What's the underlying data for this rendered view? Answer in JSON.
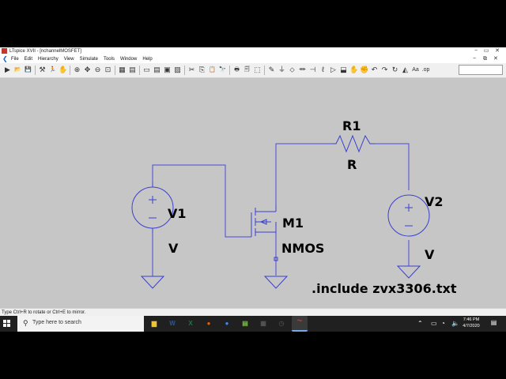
{
  "window": {
    "title": "LTspice XVII - [nchannelMOSFET]",
    "controls": [
      "−",
      "▭",
      "✕"
    ],
    "mdi_controls": [
      "−",
      "⧉",
      "✕"
    ]
  },
  "menu": {
    "back_icon": "back-arrow-icon",
    "items": [
      "File",
      "Edit",
      "Hierarchy",
      "View",
      "Simulate",
      "Tools",
      "Window",
      "Help"
    ]
  },
  "toolbar": {
    "groups": [
      [
        {
          "name": "open-icon",
          "glyph": "▶"
        },
        {
          "name": "folder-icon",
          "glyph": "📂"
        },
        {
          "name": "save-icon",
          "glyph": "💾"
        }
      ],
      [
        {
          "name": "control-panel-icon",
          "glyph": "⚒"
        },
        {
          "name": "run-icon",
          "glyph": "🏃"
        },
        {
          "name": "halt-icon",
          "glyph": "✋"
        }
      ],
      [
        {
          "name": "zoom-in-icon",
          "glyph": "⊕"
        },
        {
          "name": "pan-icon",
          "glyph": "✥"
        },
        {
          "name": "zoom-out-icon",
          "glyph": "⊖"
        },
        {
          "name": "zoom-fit-icon",
          "glyph": "⊡"
        }
      ],
      [
        {
          "name": "autorange-icon",
          "glyph": "▦"
        },
        {
          "name": "view-grid-icon",
          "glyph": "▤"
        }
      ],
      [
        {
          "name": "tile-icon",
          "glyph": "▭"
        },
        {
          "name": "cascade-icon",
          "glyph": "▤"
        },
        {
          "name": "windows-icon",
          "glyph": "▣"
        },
        {
          "name": "close-all-icon",
          "glyph": "▨"
        }
      ],
      [
        {
          "name": "cut-icon",
          "glyph": "✂"
        },
        {
          "name": "copy-icon",
          "glyph": "⎘"
        },
        {
          "name": "paste-icon",
          "glyph": "📋"
        },
        {
          "name": "find-icon",
          "glyph": "🔭"
        }
      ],
      [
        {
          "name": "print-icon",
          "glyph": "🖶"
        },
        {
          "name": "print-preview-icon",
          "glyph": "🗐"
        },
        {
          "name": "export-icon",
          "glyph": "⬚"
        }
      ],
      [
        {
          "name": "draw-wire-icon",
          "glyph": "✎"
        },
        {
          "name": "ground-icon",
          "glyph": "⏚"
        },
        {
          "name": "label-net-icon",
          "glyph": "⬦"
        },
        {
          "name": "resistor-icon",
          "glyph": "⏛"
        },
        {
          "name": "capacitor-icon",
          "glyph": "⊣"
        },
        {
          "name": "inductor-icon",
          "glyph": "ℓ"
        },
        {
          "name": "diode-icon",
          "glyph": "▷"
        },
        {
          "name": "component-icon",
          "glyph": "⬓"
        },
        {
          "name": "move-icon",
          "glyph": "✋"
        },
        {
          "name": "drag-icon",
          "glyph": "✊"
        },
        {
          "name": "undo-icon",
          "glyph": "↶"
        },
        {
          "name": "redo-icon",
          "glyph": "↷"
        },
        {
          "name": "rotate-icon",
          "glyph": "↻"
        },
        {
          "name": "mirror-icon",
          "glyph": "◭"
        },
        {
          "name": "text-icon",
          "glyph": "Aa"
        },
        {
          "name": "spice-directive-icon",
          "glyph": ".op"
        }
      ]
    ]
  },
  "schematic": {
    "components": {
      "v1": {
        "ref": "V1",
        "value": "V"
      },
      "v2": {
        "ref": "V2",
        "value": "V"
      },
      "r1": {
        "ref": "R1",
        "value": "R"
      },
      "m1": {
        "ref": "M1",
        "value": "NMOS"
      }
    },
    "directive": ".include zvx3306.txt",
    "colors": {
      "wire": "#4b4bd6",
      "component": "#3a3fcf",
      "canvas": "#c6c6c6",
      "text": "#000000"
    }
  },
  "status": {
    "text": "Type Ctrl+R to rotate or Ctrl+E to mirror."
  },
  "taskbar": {
    "search_placeholder": "Type here to search",
    "apps": [
      {
        "name": "file-explorer-icon",
        "glyph": "▆",
        "color": "#f2c230"
      },
      {
        "name": "word-icon",
        "glyph": "W",
        "color": "#2b579a"
      },
      {
        "name": "excel-icon",
        "glyph": "X",
        "color": "#217346"
      },
      {
        "name": "firefox-icon",
        "glyph": "●",
        "color": "#e66000"
      },
      {
        "name": "chrome-icon",
        "glyph": "●",
        "color": "#4285f4"
      },
      {
        "name": "notepad-icon",
        "glyph": "▤",
        "color": "#7ac142"
      },
      {
        "name": "calculator-icon",
        "glyph": "▦",
        "color": "#555555"
      },
      {
        "name": "clock-app-icon",
        "glyph": "◷",
        "color": "#444444"
      },
      {
        "name": "ltspice-icon",
        "glyph": "⏦",
        "color": "#c0392b"
      }
    ],
    "tray": {
      "time": "7:46 PM",
      "date": "4/7/2020"
    }
  }
}
